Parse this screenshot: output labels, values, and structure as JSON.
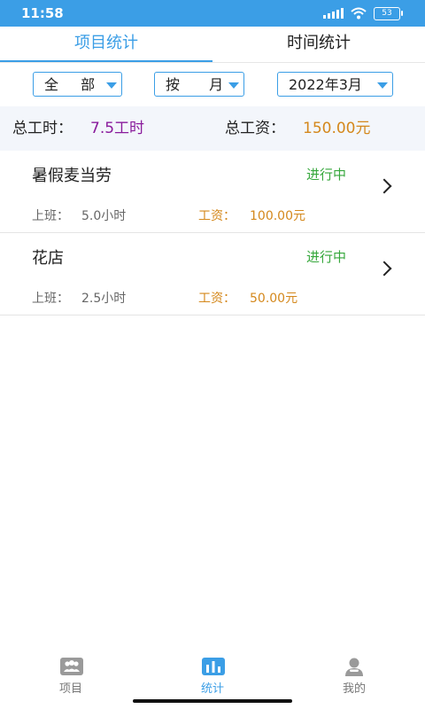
{
  "status": {
    "time": "11:58",
    "battery": "53"
  },
  "tabs": [
    {
      "label": "项目统计",
      "active": true
    },
    {
      "label": "时间统计",
      "active": false
    }
  ],
  "filters": {
    "scope": "全 部",
    "period": "按 月",
    "month": "2022年3月"
  },
  "summary": {
    "hours_label": "总工时：",
    "hours_value": "7.5工时",
    "wage_label": "总工资：",
    "wage_value": "150.00元"
  },
  "projects": [
    {
      "name": "暑假麦当劳",
      "status": "进行中",
      "work_label": "上班：",
      "work_value": "5.0小时",
      "wage_label": "工资：",
      "wage_value": "100.00元"
    },
    {
      "name": "花店",
      "status": "进行中",
      "work_label": "上班：",
      "work_value": "2.5小时",
      "wage_label": "工资：",
      "wage_value": "50.00元"
    }
  ],
  "nav": [
    {
      "label": "项目",
      "icon": "group-icon"
    },
    {
      "label": "统计",
      "icon": "bar-chart-icon"
    },
    {
      "label": "我的",
      "icon": "user-icon"
    }
  ],
  "colors": {
    "accent": "#3b9ee6",
    "status_green": "#35a73b",
    "wage_orange": "#d4881c",
    "hours_purple": "#8a1c9c"
  }
}
